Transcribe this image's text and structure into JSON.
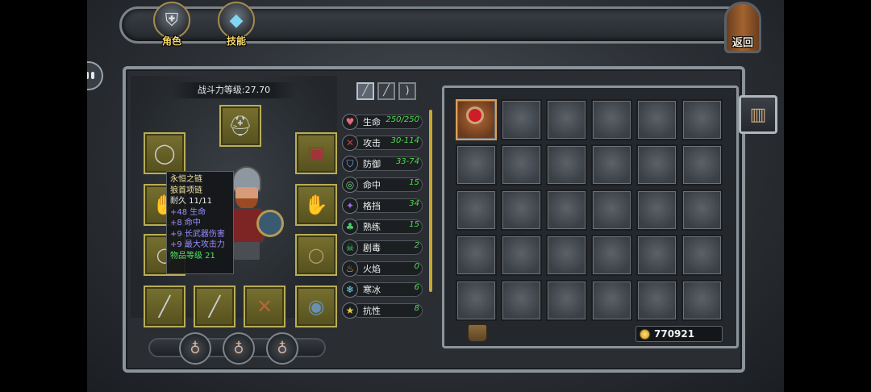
{
  "top_nav": {
    "character": {
      "label": "角色",
      "icon": "knight-helmet-icon"
    },
    "skills": {
      "label": "技能",
      "icon": "skill-book-icon"
    },
    "back": {
      "label": "返回",
      "icon": "wooden-door-icon"
    }
  },
  "character_panel": {
    "power_text": "战斗力等级:27.70",
    "weapon_tabs": [
      "sword-icon",
      "spear-icon",
      "bow-icon"
    ],
    "equipment_slots": {
      "head": "helmet-icon",
      "neck": "necklace-icon",
      "chest": "armor-icon",
      "offhand_left": "gauntlet-icon",
      "hands": "gauntlet-icon",
      "ring_left": "ring-icon",
      "ring_right": "ring-icon",
      "weapon1": "mace-icon",
      "weapon2": "spear-icon",
      "weapon3": "crossbow-icon",
      "shield": "round-shield-icon"
    },
    "potions": [
      "potion-icon",
      "potion-icon",
      "potion-icon"
    ]
  },
  "tooltip": {
    "name": "永恒之链",
    "type": "狼首项链",
    "durability": "耐久 11/11",
    "stats": [
      "+48 生命",
      "+8 命中",
      "+9 长武器伤害",
      "+9 最大攻击力"
    ],
    "item_level": "物品等级 21"
  },
  "stats": [
    {
      "name": "生命",
      "value": "250/250",
      "icon": "heart-icon",
      "color": "#e86a7a"
    },
    {
      "name": "攻击",
      "value": "30-114",
      "icon": "crossed-swords-icon",
      "color": "#d43a3a"
    },
    {
      "name": "防御",
      "value": "33-74",
      "icon": "shield-icon",
      "color": "#7ab0ea"
    },
    {
      "name": "命中",
      "value": "15",
      "icon": "target-icon",
      "color": "#7ad08a"
    },
    {
      "name": "格挡",
      "value": "34",
      "icon": "dodge-icon",
      "color": "#a46ae0"
    },
    {
      "name": "熟练",
      "value": "15",
      "icon": "clover-icon",
      "color": "#4ad06a"
    },
    {
      "name": "剧毒",
      "value": "2",
      "icon": "skull-icon",
      "color": "#4ad06a"
    },
    {
      "name": "火焰",
      "value": "0",
      "icon": "fire-icon",
      "color": "#f0a02a"
    },
    {
      "name": "寒冰",
      "value": "6",
      "icon": "snowflake-icon",
      "color": "#6ad6f0"
    },
    {
      "name": "抗性",
      "value": "8",
      "icon": "star-shield-icon",
      "color": "#e8c84a"
    }
  ],
  "inventory": {
    "gold": "770921",
    "filled_slot_icon": "ruby-ring-icon",
    "bag_icon": "backpack-icon",
    "trash_icon": "bucket-icon"
  }
}
